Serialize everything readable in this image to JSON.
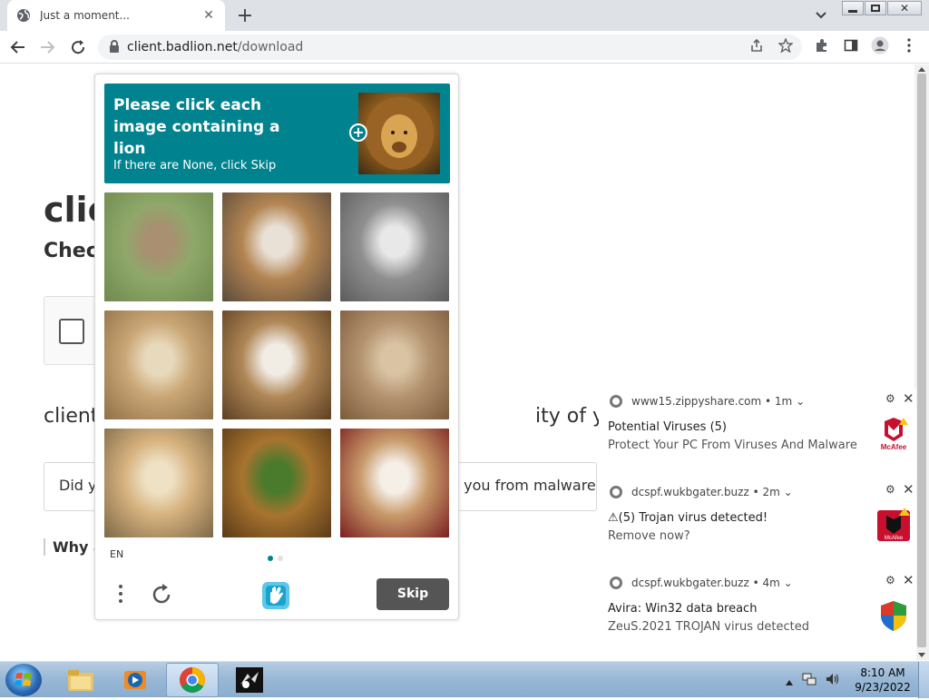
{
  "browser": {
    "tab_title": "Just a moment...",
    "url_host": "client.badlion.net",
    "url_path": "/download"
  },
  "page": {
    "heading": "clie",
    "subheading": "Check",
    "body_left": "client",
    "body_right": "ity of your con",
    "question_left": "Did yo",
    "question_right": "ct you from malware",
    "why": "Why a"
  },
  "captcha": {
    "title": "Please click each image containing a lion",
    "subtitle": "If there are None, click Skip",
    "language": "EN",
    "skip_label": "Skip",
    "accent_color": "#00838f",
    "tiles": [
      {
        "name": "horse",
        "colors": [
          "#8fa86a",
          "#a89070",
          "#6f8a4f"
        ]
      },
      {
        "name": "grumpy-cat",
        "colors": [
          "#b38552",
          "#e9e1d6",
          "#5a4a3c"
        ]
      },
      {
        "name": "gray-cat",
        "colors": [
          "#8f8f8f",
          "#e8e8e8",
          "#5c5c5c"
        ]
      },
      {
        "name": "lioness-resting",
        "colors": [
          "#c9a675",
          "#e9d9bc",
          "#8f7048"
        ]
      },
      {
        "name": "tabby-kitten",
        "colors": [
          "#b08756",
          "#f1ece4",
          "#5c3f22"
        ]
      },
      {
        "name": "lion-face",
        "colors": [
          "#b49470",
          "#d9c3a3",
          "#7a5a3a"
        ]
      },
      {
        "name": "lioness-face",
        "colors": [
          "#d6b27e",
          "#efe1c4",
          "#7d6847"
        ]
      },
      {
        "name": "lion-mane",
        "colors": [
          "#a8742f",
          "#4a7a2c",
          "#5a3a18"
        ]
      },
      {
        "name": "shiba-dog",
        "colors": [
          "#c89a6a",
          "#f5efe8",
          "#7a1e1e"
        ]
      }
    ]
  },
  "notifications": [
    {
      "source": "www15.zippyshare.com",
      "age": "1m",
      "title": "Potential Viruses (5)",
      "body": "Protect Your PC From Viruses And Malware",
      "icon": "mcafee-icon",
      "icon_label": "McAfee"
    },
    {
      "source": "dcspf.wukbgater.buzz",
      "age": "2m",
      "title": "⚠(5) Trojan virus detected!",
      "body": "Remove now?",
      "icon": "mcafee-shield-icon",
      "icon_label": "McAfee"
    },
    {
      "source": "dcspf.wukbgater.buzz",
      "age": "4m",
      "title": "Avira: Win32 data breach",
      "body": "ZeuS.2021 TROJAN virus detected",
      "icon": "windows-shield-icon",
      "icon_label": ""
    }
  ],
  "taskbar": {
    "time": "8:10 AM",
    "date": "9/23/2022"
  }
}
